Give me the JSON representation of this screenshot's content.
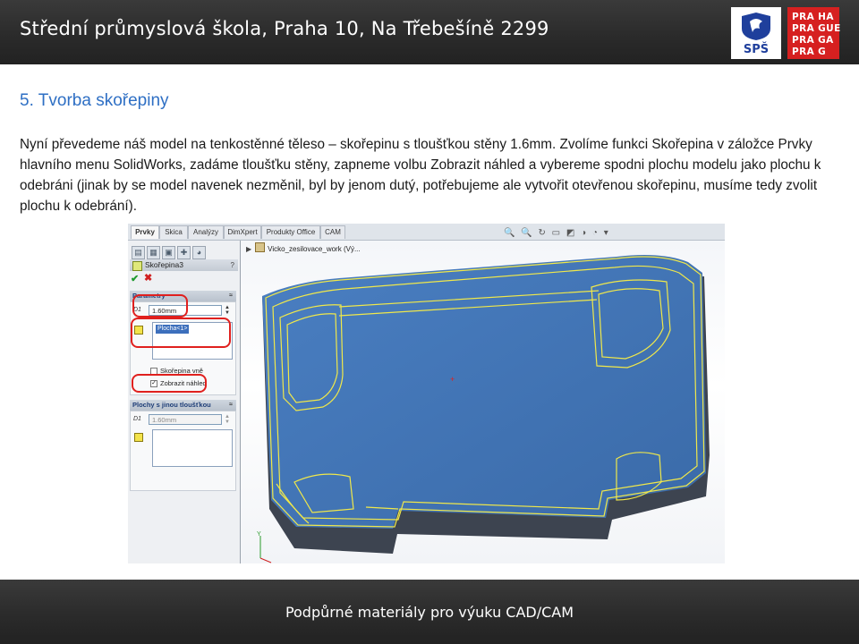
{
  "header": {
    "title": "Střední průmyslová škola, Praha 10, Na Třebešíně 2299",
    "logo_sps": "SPŠ",
    "logo_praha": [
      "PRA HA",
      "PRA GUE",
      "PRA GA",
      "PRA G"
    ]
  },
  "heading": "5. Tvorba skořepiny",
  "paragraph": "Nyní převedeme náš model na tenkostěnné těleso – skořepinu s tloušťkou stěny 1.6mm. Zvolíme funkci Skořepina v záložce Prvky hlavního menu SolidWorks, zadáme tloušťku stěny, zapneme volbu Zobrazit náhled a vybereme spodni plochu modelu jako plochu k odebráni (jinak by se model navenek nezměnil, byl by jenom dutý, potřebujeme ale vytvořit otevřenou skořepinu, musíme tedy zvolit plochu k odebrání).",
  "screenshot": {
    "tabs": [
      "Prvky",
      "Skica",
      "Analýzy",
      "DimXpert",
      "Produkty Office",
      "CAM"
    ],
    "active_tab": "Prvky",
    "feature_title": "Skořepina3",
    "help": "?",
    "ok_symbol": "✔",
    "cancel_symbol": "✖",
    "group_params": "Parametry",
    "thickness_symbol": "D1",
    "thickness": "1.60mm",
    "faces_item": "Plocha<1>",
    "option_outward": "Skořepina vně",
    "option_outward_checked": false,
    "option_preview": "Zobrazit náhled",
    "option_preview_checked": true,
    "group_multi": "Plochy s jinou tloušťkou",
    "multi_thickness": "1.60mm",
    "tree_item": "Vicko_zesilovace_work (Vý...",
    "view_icons": "🔍 🔍 ↻ ▭ ◩ ◑ ◔ ▾"
  },
  "colors": {
    "accent_heading": "#2e6fc4",
    "header_bg": "#2b2b2b",
    "model_face": "#3f74b8",
    "highlight": "#e0201e",
    "edge": "#f0e84a"
  },
  "footer": "Podpůrné materiály pro výuku CAD/CAM"
}
